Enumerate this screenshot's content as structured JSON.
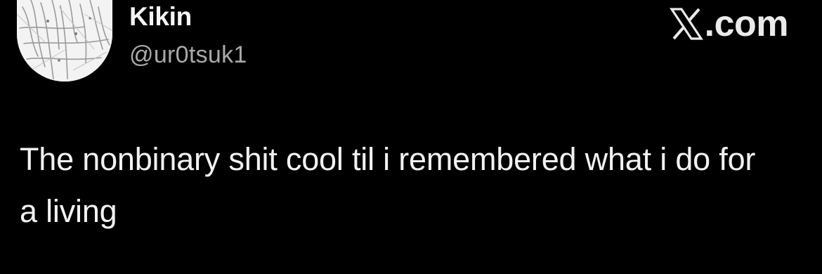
{
  "author": {
    "display_name": "Kikin",
    "handle": "@ur0tsuk1",
    "avatar": "avatar-image"
  },
  "brand": {
    "logo_icon": "x-logo-icon",
    "domain": ".com"
  },
  "tweet": {
    "text": "The nonbinary shit cool til i remembered what i do for a living"
  },
  "colors": {
    "background": "#000000",
    "primary_text": "#f2f2f2",
    "secondary_text": "#a9a9a9"
  }
}
